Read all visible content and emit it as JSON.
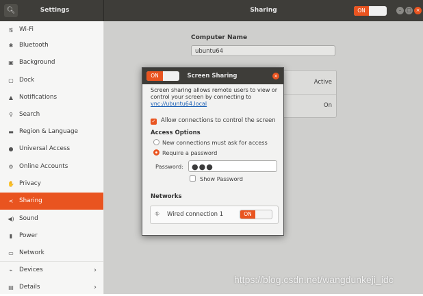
{
  "header": {
    "app_title": "Settings",
    "panel_title": "Sharing",
    "sharing_toggle": "ON",
    "search_icon": "search-icon",
    "window_buttons": [
      "minimize",
      "maximize",
      "close"
    ]
  },
  "sidebar": {
    "items": [
      {
        "label": "Wi-Fi",
        "icon": "wifi-icon"
      },
      {
        "label": "Bluetooth",
        "icon": "bluetooth-icon"
      },
      {
        "label": "Background",
        "icon": "background-icon"
      },
      {
        "label": "Dock",
        "icon": "dock-icon"
      },
      {
        "label": "Notifications",
        "icon": "bell-icon"
      },
      {
        "label": "Search",
        "icon": "search-icon"
      },
      {
        "label": "Region & Language",
        "icon": "region-icon"
      },
      {
        "label": "Universal Access",
        "icon": "accessibility-icon"
      },
      {
        "label": "Online Accounts",
        "icon": "accounts-icon"
      },
      {
        "label": "Privacy",
        "icon": "privacy-icon"
      },
      {
        "label": "Sharing",
        "icon": "share-icon",
        "active": true
      },
      {
        "label": "Sound",
        "icon": "speaker-icon"
      },
      {
        "label": "Power",
        "icon": "power-icon"
      },
      {
        "label": "Network",
        "icon": "network-icon"
      },
      {
        "label": "Devices",
        "icon": "devices-icon",
        "chevron": true
      },
      {
        "label": "Details",
        "icon": "details-icon",
        "chevron": true
      }
    ]
  },
  "main": {
    "computer_name_label": "Computer Name",
    "computer_name_value": "ubuntu64",
    "rows": [
      {
        "value": "Active"
      },
      {
        "value": "On"
      }
    ]
  },
  "dialog": {
    "toggle": "ON",
    "title": "Screen Sharing",
    "description_prefix": "Screen sharing allows remote users to view or control your screen by connecting to ",
    "description_link": "vnc://ubuntu64.local",
    "allow_control_label": "Allow connections to control the screen",
    "access_options_title": "Access Options",
    "option_new_connections": "New connections must ask for access",
    "option_require_password": "Require a password",
    "password_label": "Password:",
    "password_value": "●●●",
    "show_password_label": "Show Password",
    "networks_title": "Networks",
    "network_name": "Wired connection 1",
    "network_toggle": "ON"
  },
  "watermark": "https://blog.csdn.net/wangdunkeji_idc",
  "colors": {
    "accent": "#e95420",
    "headerbar": "#3e3d39",
    "sidebar_bg": "#f6f6f5",
    "dimmed_bg": "#cfcfcd"
  }
}
